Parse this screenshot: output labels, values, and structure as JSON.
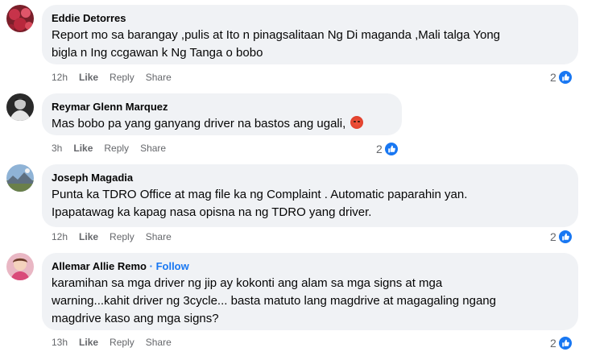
{
  "colors": {
    "bubble": "#f0f2f5",
    "link": "#1877f2",
    "meta": "#65676b"
  },
  "comments": [
    {
      "author": "Eddie Detorres",
      "follow": "",
      "text": "Report mo sa barangay ,pulis at Ito n pinagsalitaan Ng Di maganda ,Mali talga Yong\nbigla n Ing ccgawan k Ng Tanga o bobo",
      "emoji": "",
      "time": "12h",
      "like": "Like",
      "reply": "Reply",
      "share": "Share",
      "reactions": "2",
      "avatar_icon": "avatar-red-flowers"
    },
    {
      "author": "Reymar Glenn Marquez",
      "follow": "",
      "text": "Mas bobo pa yang ganyang driver na bastos ang ugali,",
      "emoji": "angry-face-emoji",
      "time": "3h",
      "like": "Like",
      "reply": "Reply",
      "share": "Share",
      "reactions": "2",
      "avatar_icon": "avatar-dark-portrait"
    },
    {
      "author": "Joseph Magadia",
      "follow": "",
      "text": "Punta ka TDRO Office at mag file ka ng Complaint . Automatic paparahin yan.\nIpapatawag ka kapag nasa opisna na ng TDRO yang driver.",
      "emoji": "",
      "time": "12h",
      "like": "Like",
      "reply": "Reply",
      "share": "Share",
      "reactions": "2",
      "avatar_icon": "avatar-landscape"
    },
    {
      "author": "Allemar Allie Remo",
      "follow": "· Follow",
      "text": "karamihan sa mga driver ng jip ay kokonti ang alam sa mga signs at mga\nwarning...kahit driver ng 3cycle... basta matuto lang magdrive at magagaling ngang\nmagdrive kaso ang mga signs?",
      "emoji": "",
      "time": "13h",
      "like": "Like",
      "reply": "Reply",
      "share": "Share",
      "reactions": "2",
      "avatar_icon": "avatar-pink-portrait"
    }
  ]
}
